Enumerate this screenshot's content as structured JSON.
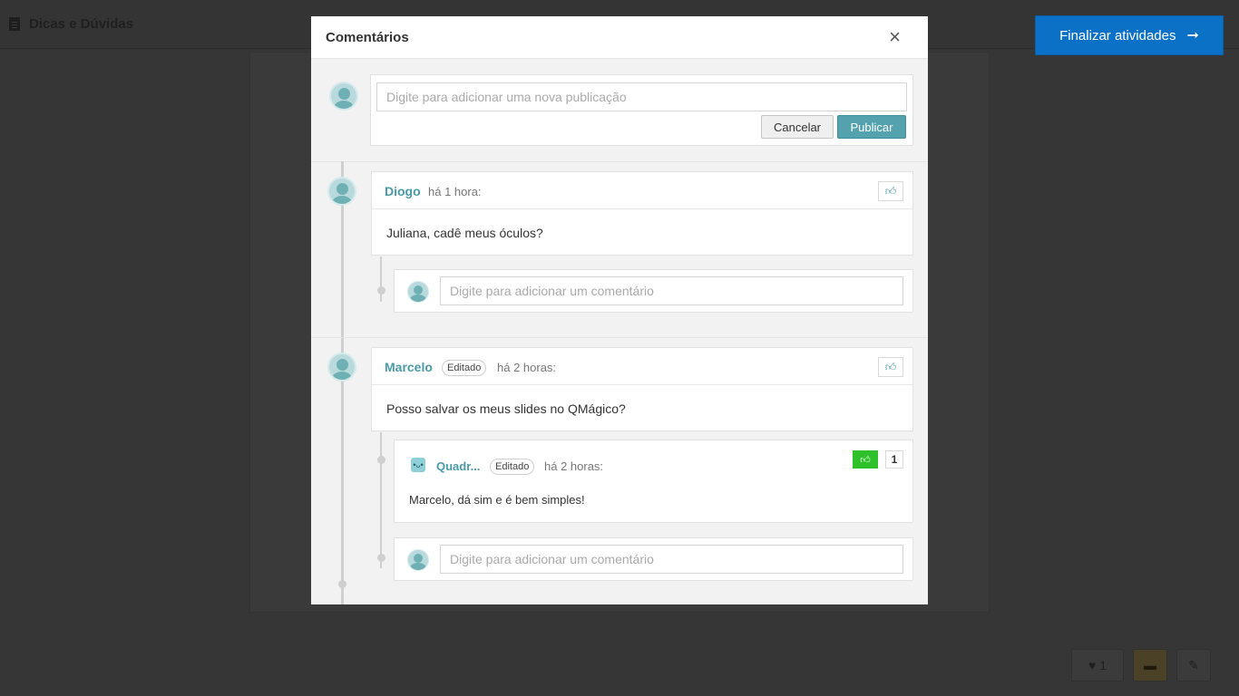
{
  "topbar": {
    "title": "Dicas e Dúvidas",
    "finish_label": "Finalizar atividades",
    "finish_icon": "arrow-right-icon"
  },
  "modal": {
    "title": "Comentários",
    "close_symbol": "×",
    "new_post": {
      "placeholder": "Digite para adicionar uma nova publicação",
      "cancel_label": "Cancelar",
      "publish_label": "Publicar"
    },
    "posts": [
      {
        "author": "Diogo",
        "edited": false,
        "time": "há 1 hora:",
        "body": "Juliana, cadê meus óculos?",
        "comment_placeholder": "Digite para adicionar um comentário"
      },
      {
        "author": "Marcelo",
        "edited": true,
        "edited_label": "Editado",
        "time": "há 2 horas:",
        "body": "Posso salvar os meus slides no QMágico?",
        "replies": [
          {
            "author": "Quadr...",
            "edited_label": "Editado",
            "time": "há 2 horas:",
            "body": "Marcelo, dá sim e é bem simples!",
            "likes": "1",
            "liked": true
          }
        ],
        "comment_placeholder": "Digite para adicionar um comentário"
      }
    ]
  },
  "bottom_actions": {
    "likes_count": "1"
  },
  "colors": {
    "accent": "#4a9aa5",
    "primary_blue": "#0b71c7",
    "like_green": "#2ec12b",
    "publish": "#53a2ae"
  }
}
